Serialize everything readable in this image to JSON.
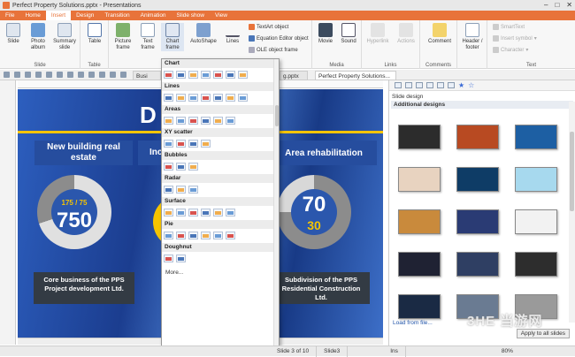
{
  "window": {
    "title": "Perfect Property Solutions.pptx - Presentations"
  },
  "menu": [
    "File",
    "Home",
    "Insert",
    "Design",
    "Transition",
    "Animation",
    "Slide show",
    "View"
  ],
  "ribbon": {
    "slide_group": {
      "buttons": [
        "Slide",
        "Photo album",
        "Summary slide"
      ],
      "label": "Slide"
    },
    "table_group": {
      "buttons": [
        "Table"
      ],
      "label": "Table"
    },
    "objects": {
      "buttons": [
        "Picture frame",
        "Text frame",
        "Chart frame",
        "AutoShape",
        "Lines"
      ],
      "small": [
        "TextArt object",
        "Equation Editor object",
        "OLE object frame"
      ]
    },
    "media_group": {
      "buttons": [
        "Movie",
        "Sound"
      ],
      "label": "Media"
    },
    "links_group": {
      "buttons": [
        "Hyperlink",
        "Actions"
      ],
      "label": "Links"
    },
    "comments_group": {
      "buttons": [
        "Comment"
      ],
      "label": "Comments"
    },
    "header": {
      "buttons": [
        "Header / footer"
      ]
    },
    "text_group": {
      "small": [
        "SmartText",
        "Insert symbol",
        "Character"
      ],
      "label": "Text"
    }
  },
  "doc_tabs": {
    "left": "Busi",
    "middle": "g.pptx",
    "active": "Perfect Property Solutions..."
  },
  "chart_menu": {
    "header": "Chart",
    "sections": [
      "Lines",
      "Areas",
      "XY scatter",
      "Bubbles",
      "Radar",
      "Surface",
      "Pie",
      "Doughnut"
    ],
    "more": "More..."
  },
  "slide": {
    "title_letter": "D",
    "box_left": "New building real estate",
    "box_mid": "Inc",
    "box_right": "Area rehabilitation",
    "donut_left": {
      "small": "175 / 75",
      "big": "750"
    },
    "donut_right": {
      "big": "70",
      "small": "30"
    },
    "caption_left": "Core business of the PPS Project development Ltd.",
    "caption_right": "Subdivision of the PPS Residential Construction Ltd."
  },
  "panel": {
    "title": "Slide design",
    "subtitle": "Additional designs",
    "load": "Load from file...",
    "apply": "Apply to all slides"
  },
  "status": {
    "slide": "Slide 3 of 10",
    "name": "Slide3",
    "mode": "Ins",
    "zoom": "80%"
  },
  "watermark": "3HE 当游网",
  "colors": {
    "accent": "#e8733a",
    "slide_bg": "#1e3c8e",
    "yellow": "#f5c400"
  }
}
